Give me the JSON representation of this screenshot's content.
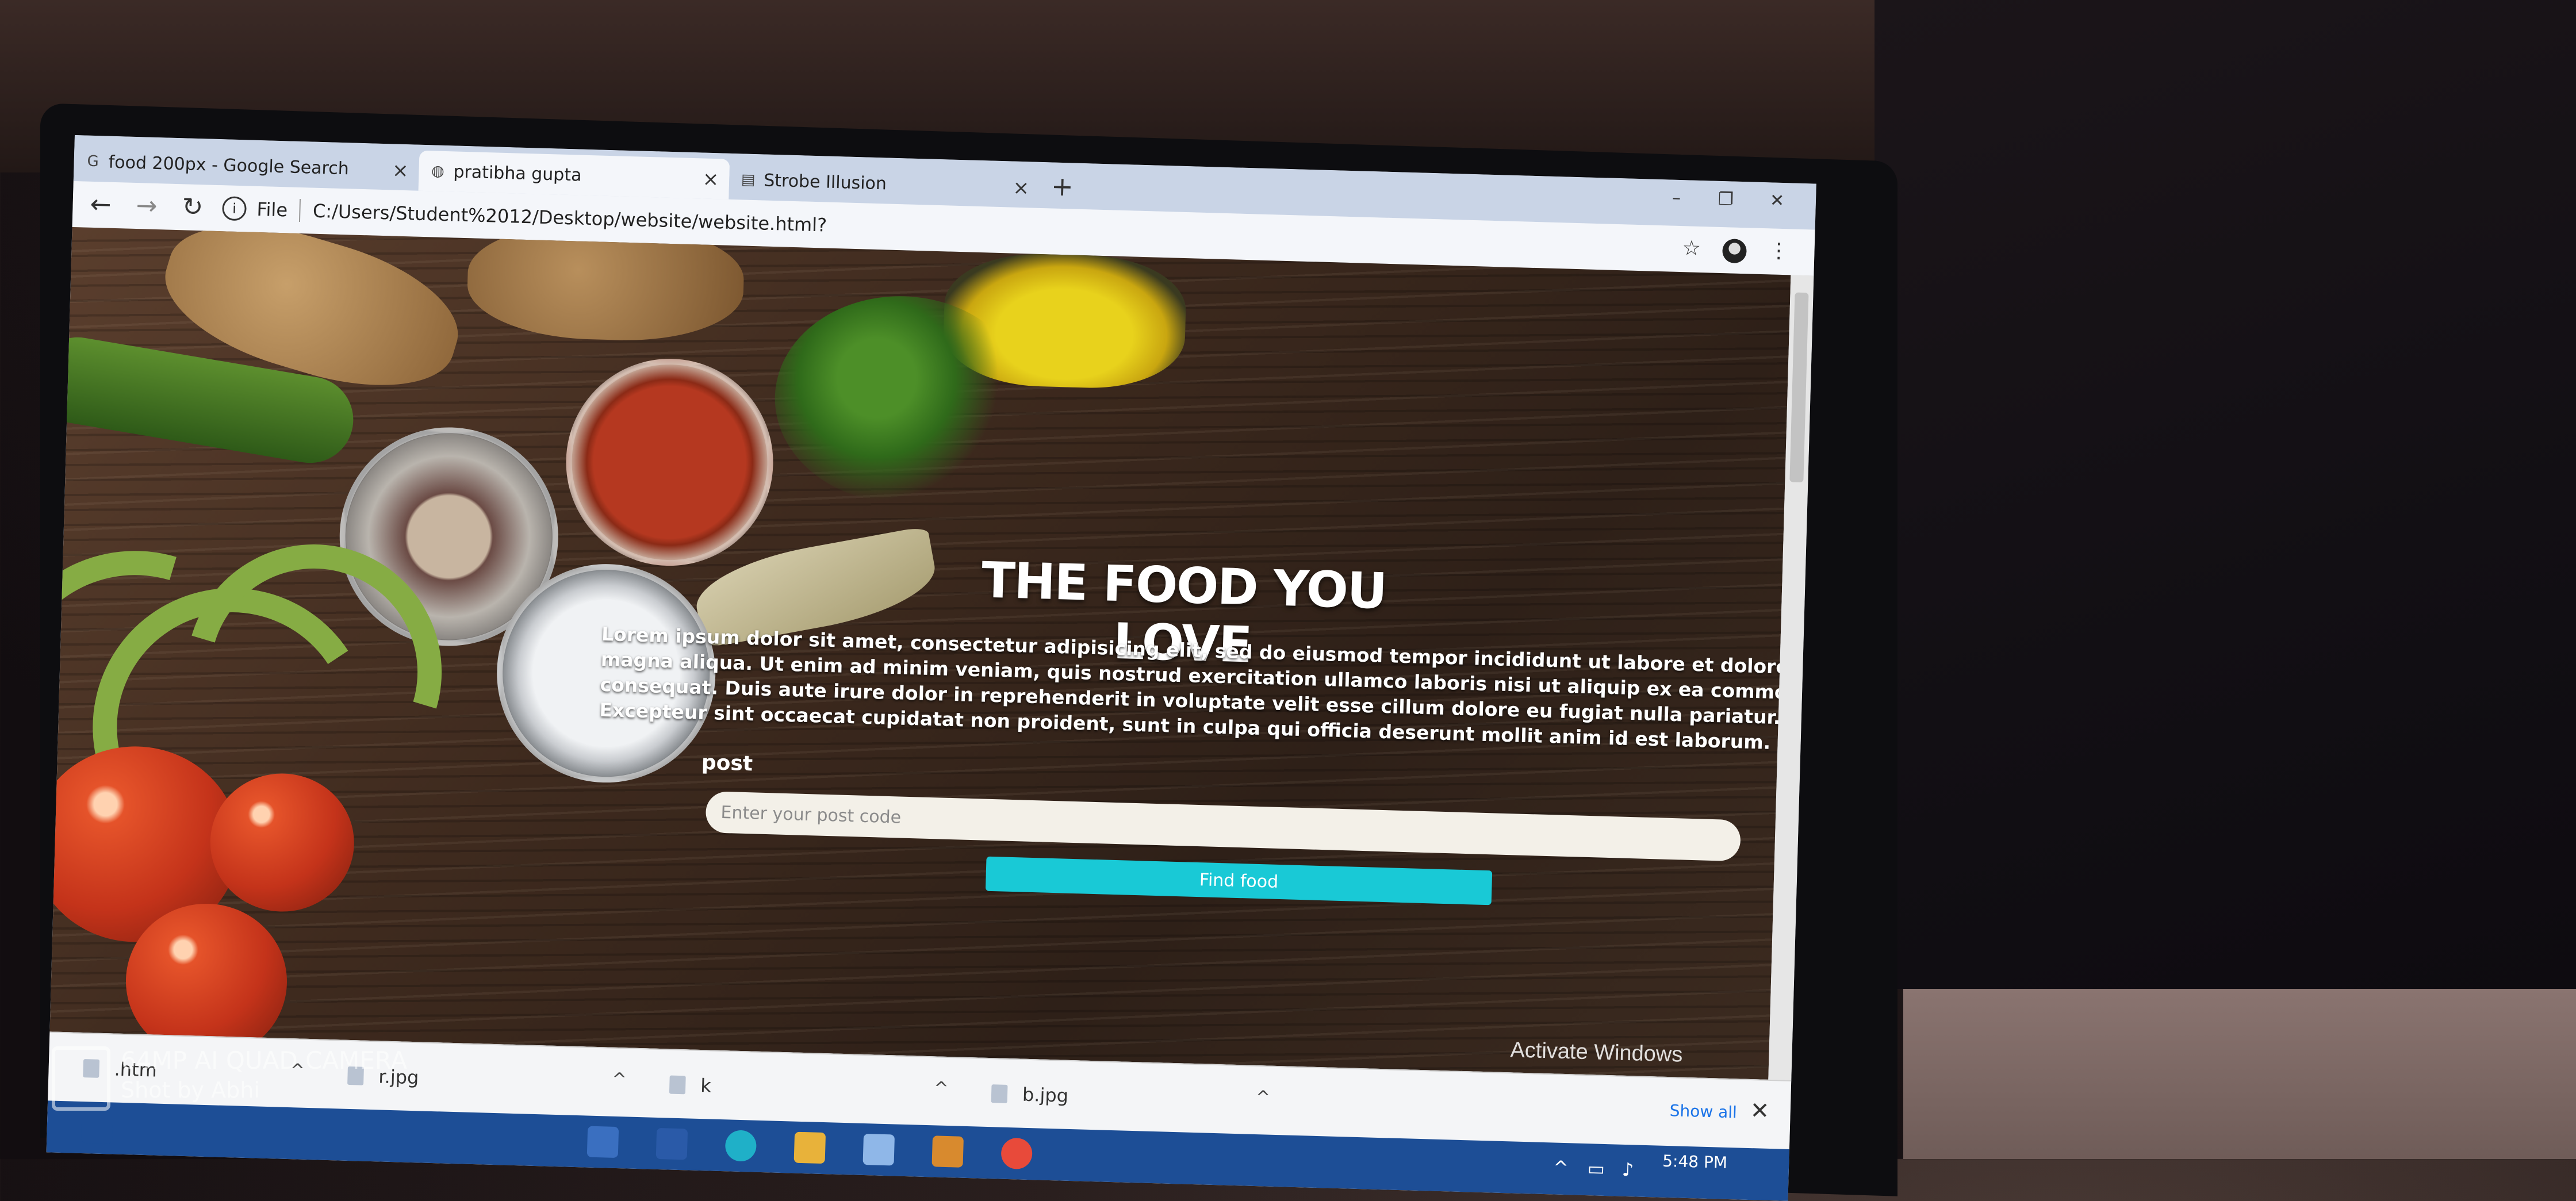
{
  "browser": {
    "tabs": [
      {
        "label": "food 200px - Google Search",
        "icon": "google-icon"
      },
      {
        "label": "pratibha gupta",
        "icon": "globe-icon"
      },
      {
        "label": "Strobe Illusion",
        "icon": "strobe-icon"
      }
    ],
    "omnibox": {
      "scheme_label": "File",
      "url": "C:/Users/Student%2012/Desktop/website/website.html?"
    }
  },
  "page": {
    "title": "THE FOOD YOU LOVE",
    "paragraph": "Lorem ipsum dolor sit amet, consectetur adipisicing elit, sed do eiusmod tempor incididunt ut labore et dolore magna aliqua. Ut enim ad minim veniam, quis nostrud exercitation ullamco laboris nisi ut aliquip ex ea commodo consequat. Duis aute irure dolor in reprehenderit in voluptate velit esse cillum dolore eu fugiat nulla pariatur. Excepteur sint occaecat cupidatat non proident, sunt in culpa qui officia deserunt mollit anim id est laborum.",
    "post_label": "post",
    "post_placeholder": "Enter your post code",
    "find_button": "Find food",
    "button_color": "#19c9d6"
  },
  "os": {
    "activate_windows": "Activate Windows",
    "clock": "5:48 PM"
  },
  "downloads": {
    "items": [
      ".htm",
      "r.jpg",
      "k",
      "b.jpg"
    ],
    "show_all": "Show all"
  },
  "watermark": {
    "line1": "64MP AI QUAD CAMERA",
    "line2": "Shot by Abhi"
  }
}
